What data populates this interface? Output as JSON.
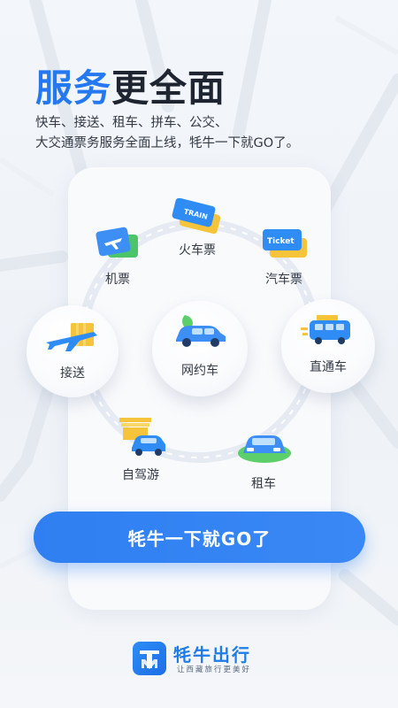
{
  "headline": {
    "part1": "服务",
    "part2": "更全面"
  },
  "subtitle": {
    "line1": "快车、接送、租车、拼车、公交、",
    "line2": "大交通票务服务全面上线，牦牛一下就GO了。"
  },
  "services": {
    "train": "火车票",
    "flight": "机票",
    "bus_ticket": "汽车票",
    "pickup": "接送",
    "ride_hailing": "网约车",
    "shuttle": "直通车",
    "self_drive": "自驾游",
    "rental": "租车"
  },
  "icon_text": {
    "train": "TRAIN",
    "ticket": "Ticket"
  },
  "cta": {
    "label": "牦牛一下就GO了"
  },
  "brand": {
    "name": "牦牛出行",
    "slogan": "让西藏旅行更美好"
  }
}
